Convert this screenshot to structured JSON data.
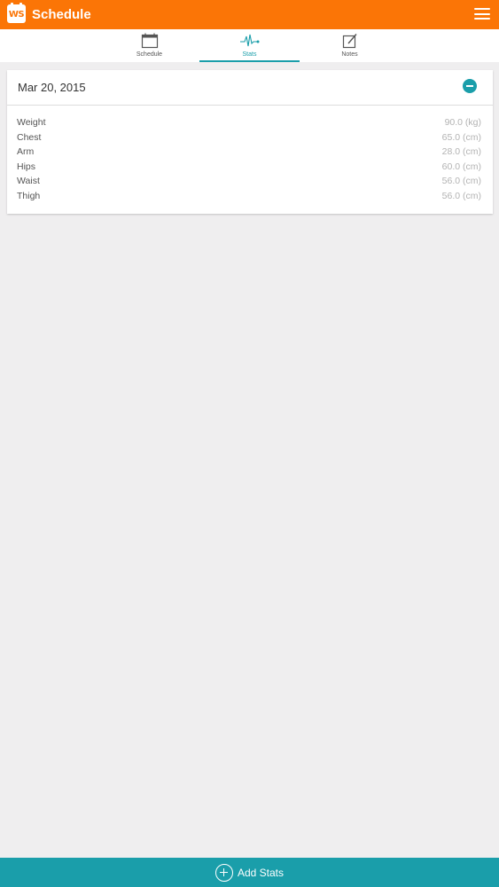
{
  "appbar": {
    "logo_text": "WS",
    "title": "Schedule",
    "menu_icon": "hamburger-menu-icon",
    "background": "#fb7506"
  },
  "tabs": [
    {
      "label": "Schedule",
      "icon": "calendar-icon",
      "active": false
    },
    {
      "label": "Stats",
      "icon": "heartbeat-icon",
      "active": true
    },
    {
      "label": "Notes",
      "icon": "edit-note-icon",
      "active": false
    }
  ],
  "accent": "#1a9eaa",
  "card": {
    "date": "Mar 20, 2015",
    "collapse_icon": "minus-circle-icon",
    "stats": [
      {
        "name": "Weight",
        "value": "90.0 (kg)"
      },
      {
        "name": "Chest",
        "value": "65.0 (cm)"
      },
      {
        "name": "Arm",
        "value": "28.0 (cm)"
      },
      {
        "name": "Hips",
        "value": "60.0 (cm)"
      },
      {
        "name": "Waist",
        "value": "56.0 (cm)"
      },
      {
        "name": "Thigh",
        "value": "56.0 (cm)"
      }
    ]
  },
  "add_button": {
    "label": "Add Stats",
    "icon": "plus-circle-icon"
  }
}
